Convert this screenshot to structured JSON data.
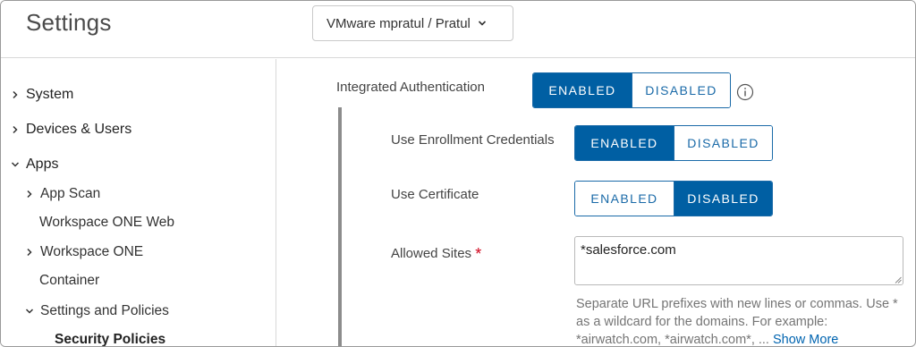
{
  "header": {
    "title": "Settings",
    "org_selector": "VMware mpratul / Pratul"
  },
  "sidebar": {
    "items": [
      {
        "label": "System"
      },
      {
        "label": "Devices & Users"
      },
      {
        "label": "Apps"
      },
      {
        "label": "App Scan"
      },
      {
        "label": "Workspace ONE Web"
      },
      {
        "label": "Workspace ONE"
      },
      {
        "label": "Container"
      },
      {
        "label": "Settings and Policies"
      },
      {
        "label": "Security Policies"
      }
    ]
  },
  "main": {
    "integrated_auth": {
      "label": "Integrated Authentication",
      "enabled": "ENABLED",
      "disabled": "DISABLED",
      "selected": "ENABLED"
    },
    "enrollment_credentials": {
      "label": "Use Enrollment Credentials",
      "enabled": "ENABLED",
      "disabled": "DISABLED",
      "selected": "ENABLED"
    },
    "use_certificate": {
      "label": "Use Certificate",
      "enabled": "ENABLED",
      "disabled": "DISABLED",
      "selected": "DISABLED"
    },
    "allowed_sites": {
      "label": "Allowed Sites",
      "required_mark": "*",
      "value": "*salesforce.com",
      "help_text": "Separate URL prefixes with new lines or commas. Use * as a wildcard for the domains. For example: *airwatch.com, *airwatch.com*, ...",
      "show_more": "Show More"
    }
  },
  "colors": {
    "accent": "#005fa3",
    "link": "#0064b0",
    "required": "#d0021b"
  }
}
